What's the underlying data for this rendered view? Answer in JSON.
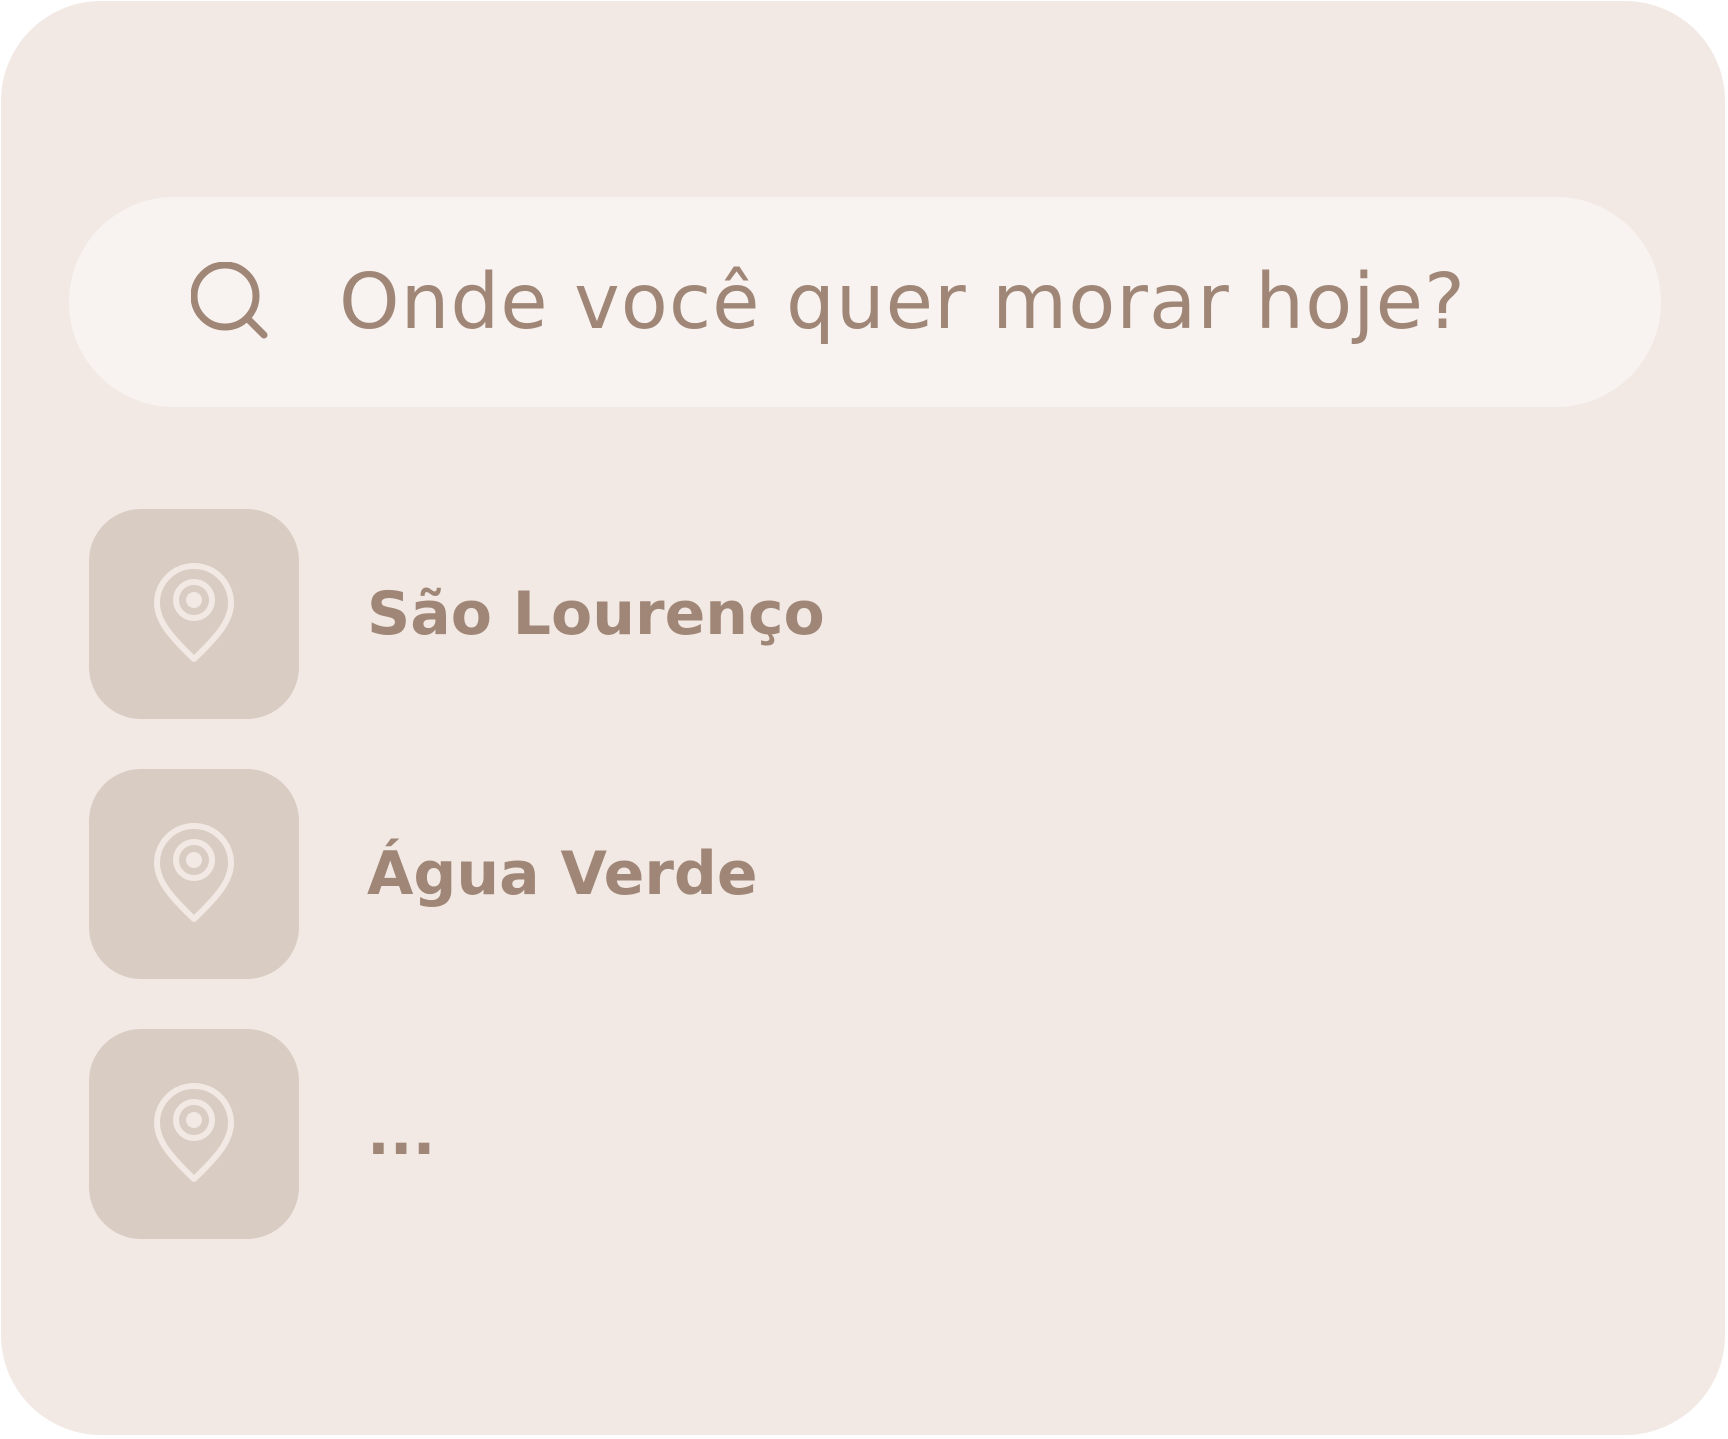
{
  "search": {
    "placeholder": "Onde você quer morar hoje?",
    "icon": "search-icon"
  },
  "locations": [
    {
      "label": "São Lourenço",
      "icon": "location-pin-icon"
    },
    {
      "label": "Água Verde",
      "icon": "location-pin-icon"
    },
    {
      "label": "...",
      "icon": "location-pin-icon"
    }
  ],
  "colors": {
    "background": "#f2e9e4",
    "search_bg": "#f8f3f0",
    "tile": "#d9ccc3",
    "text": "#a08676",
    "pin": "#f2e9e4"
  }
}
